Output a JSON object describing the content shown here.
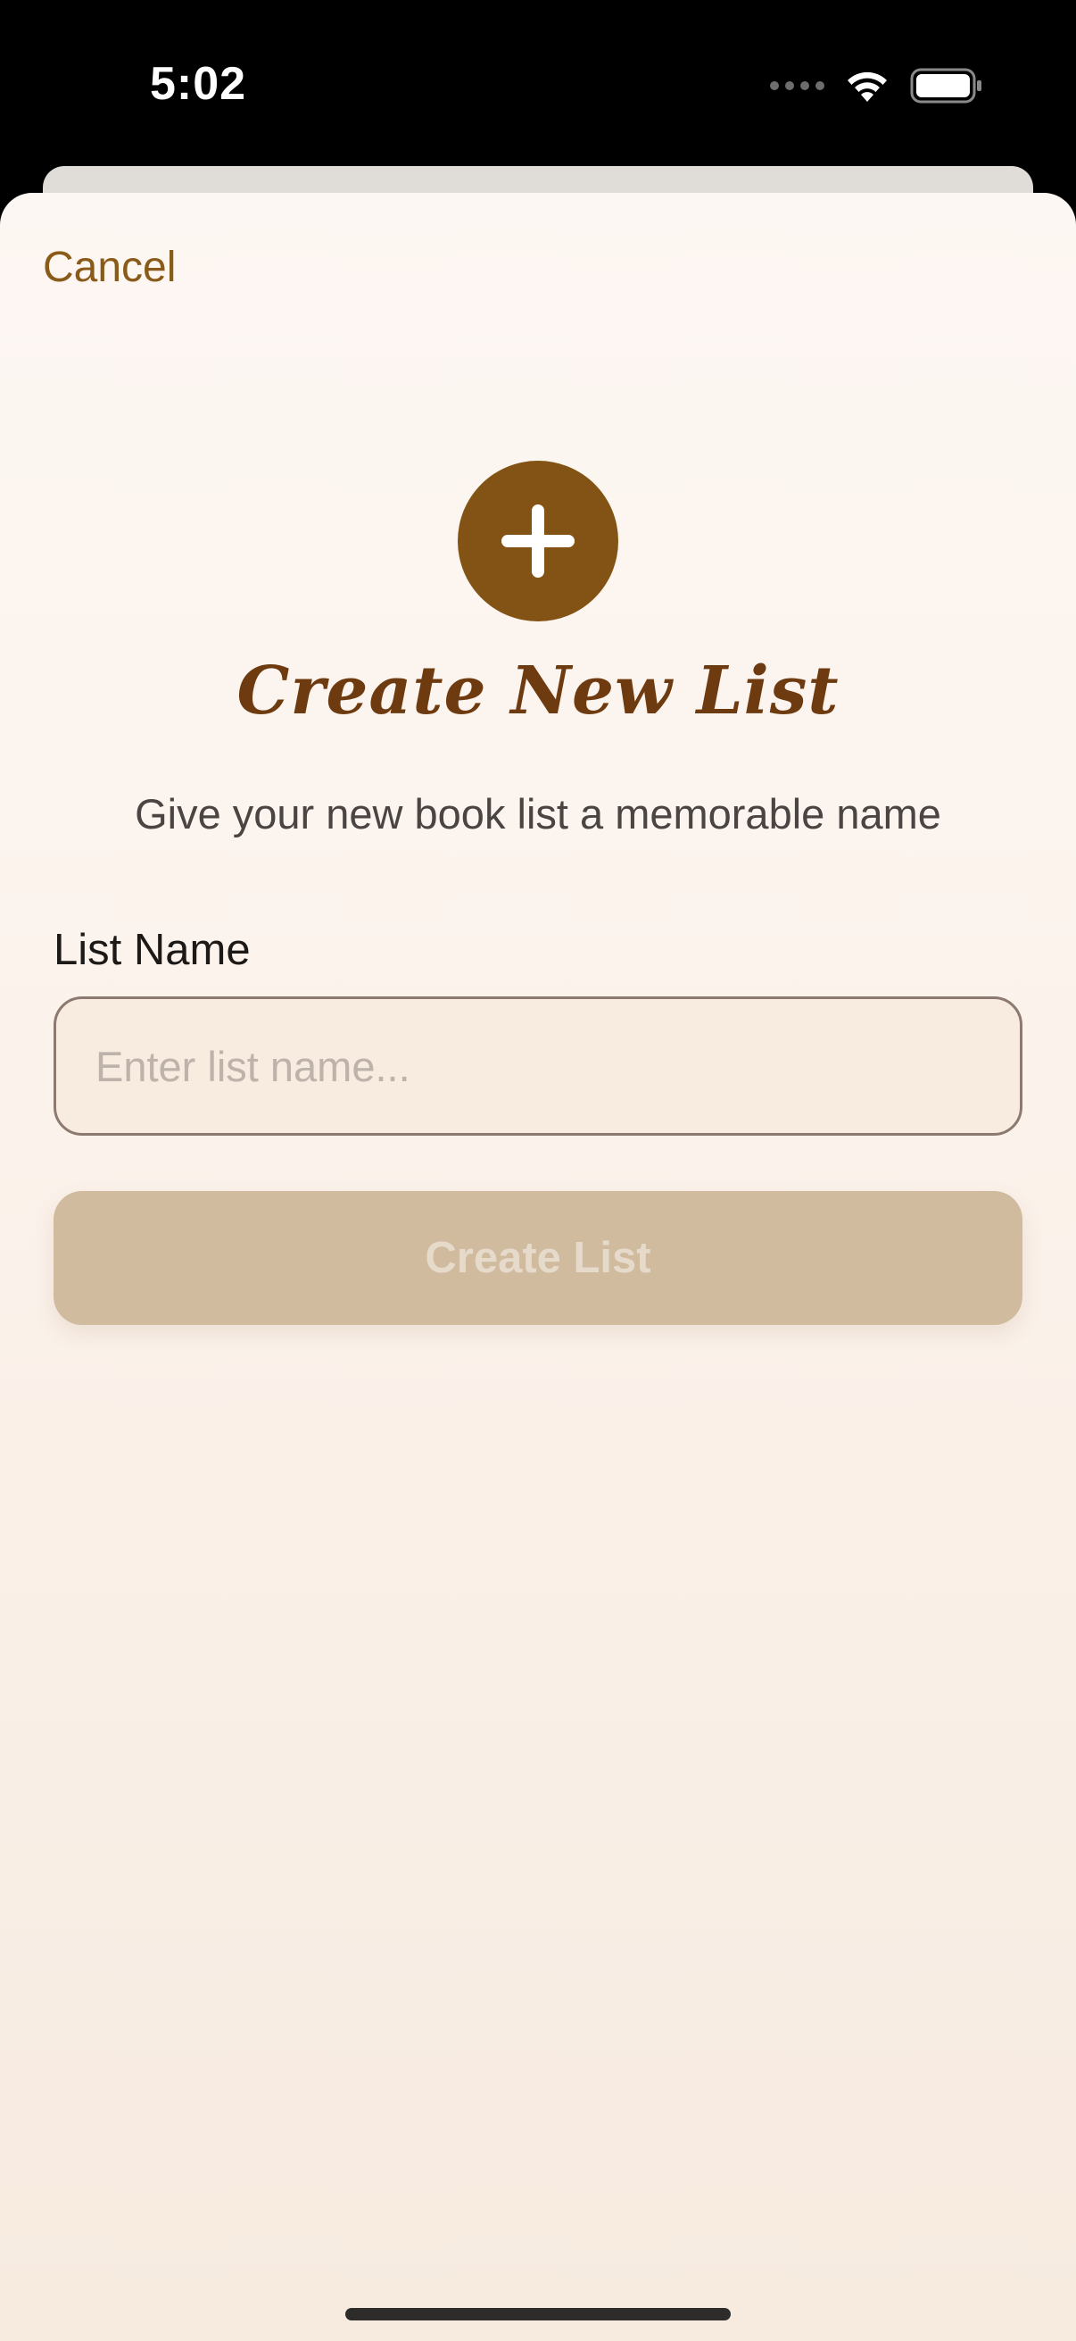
{
  "status_bar": {
    "time": "5:02",
    "icons": [
      "signal-dots-icon",
      "wifi-icon",
      "battery-icon"
    ]
  },
  "sheet": {
    "cancel_label": "Cancel",
    "header_icon": "plus-icon",
    "title": "Create New List",
    "subtitle": "Give your new book list a memorable name",
    "field_label": "List Name",
    "input_value": "",
    "input_placeholder": "Enter list name...",
    "create_button_label": "Create List"
  },
  "colors": {
    "accent": "#825314",
    "title": "#6e3b10",
    "cancel": "#8a5a18",
    "button_disabled": "#d0bb9f",
    "sheet_background": "#fdf7f3"
  }
}
